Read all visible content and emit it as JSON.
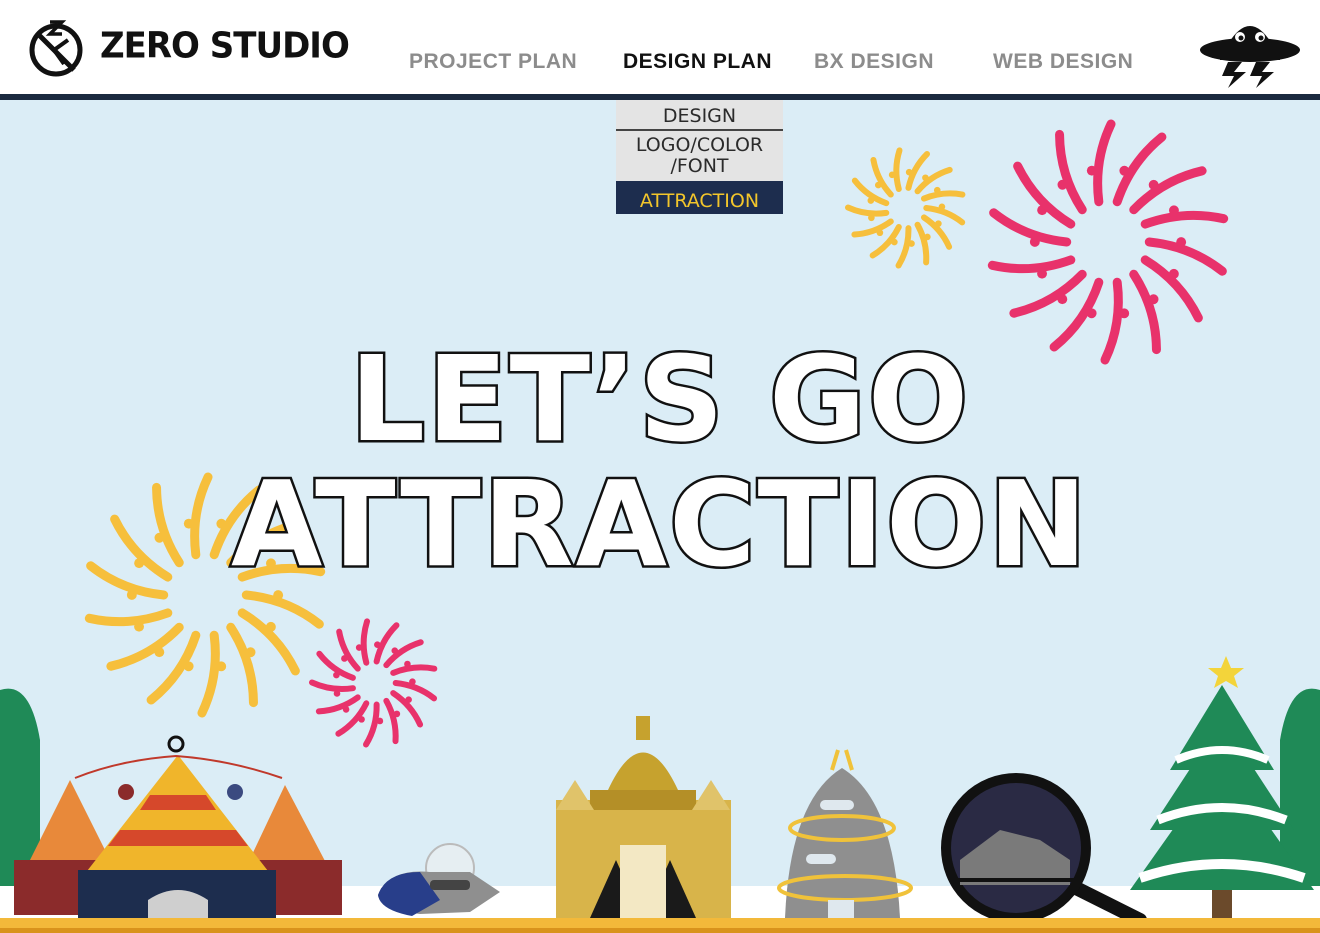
{
  "brand": {
    "name": "ZERO STUDIO"
  },
  "nav": {
    "items": [
      {
        "label": "PROJECT PLAN",
        "active": false
      },
      {
        "label": "DESIGN PLAN",
        "active": true
      },
      {
        "label": "BX DESIGN",
        "active": false
      },
      {
        "label": "WEB DESIGN",
        "active": false
      }
    ]
  },
  "submenu": {
    "items": [
      {
        "label": "DESIGN",
        "selected": false
      },
      {
        "label": "LOGO/COLOR",
        "label2": "/FONT",
        "selected": false
      },
      {
        "label": "ATTRACTION",
        "selected": true
      }
    ]
  },
  "hero": {
    "line1": "LET’S GO",
    "line2": "ATTRACTION"
  },
  "colors": {
    "background": "#dbedf6",
    "header_rule": "#1b2a40",
    "accent_navy": "#1d2d4e",
    "accent_yellow": "#f3c62b",
    "firework_pink": "#e8326b",
    "firework_yellow": "#f6bf3c",
    "nav_inactive": "#8c8c8c"
  },
  "icons": [
    "logo-mark-icon",
    "ufo-mascot-icon",
    "firework-icon",
    "circus-tent-icon",
    "spaceship-icon",
    "palace-icon",
    "rocket-tower-icon",
    "magnifier-train-icon",
    "christmas-tree-icon"
  ]
}
